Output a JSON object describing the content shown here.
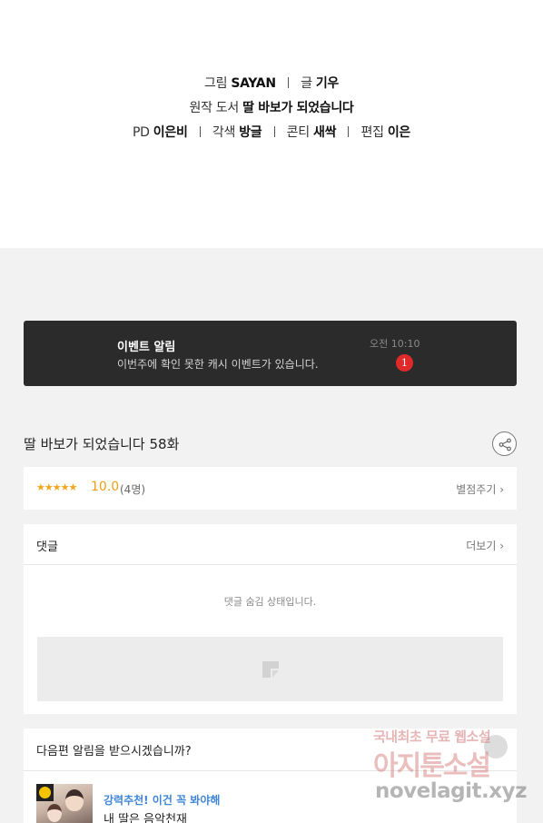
{
  "credits": {
    "line1": {
      "art_label": "그림",
      "art_name": "SAYAN",
      "story_label": "글",
      "story_name": "기우"
    },
    "line2": {
      "original_label": "원작 도서",
      "original_title": "딸 바보가 되었습니다"
    },
    "line3": {
      "pd_label": "PD",
      "pd_name": "이은비",
      "adapt_label": "각색",
      "adapt_name": "방글",
      "conti_label": "콘티",
      "conti_name": "새싹",
      "edit_label": "편집",
      "edit_name": "이은"
    }
  },
  "event": {
    "title": "이벤트 알림",
    "description": "이번주에 확인 못한 캐시 이벤트가 있습니다.",
    "time": "오전 10:10",
    "badge_count": "1"
  },
  "episode": {
    "title": "딸 바보가 되었습니다 58화"
  },
  "rating": {
    "stars": "★★★★★",
    "score": "10.0",
    "count": "(4명)",
    "rate_link": "별점주기 ›"
  },
  "comments": {
    "title": "댓글",
    "more_link": "더보기 ›",
    "hidden_message": "댓글 숨김 상태입니다."
  },
  "next_alert": {
    "question": "다음편 알림을 받으시겠습니까?",
    "recommend_tag": "강력추천! 이건 꼭 봐야해",
    "recommend_title": "내 딸은 음악천재"
  },
  "watermark": {
    "line1": "국내최초 무료 웹소설",
    "line2": "아지툰소설",
    "line3": "novelagit.xyz"
  },
  "colors": {
    "event_bg": "#2b2b2b",
    "badge": "#e02a2a",
    "star": "#f0a51c",
    "recommend_tag": "#3f86d6"
  }
}
